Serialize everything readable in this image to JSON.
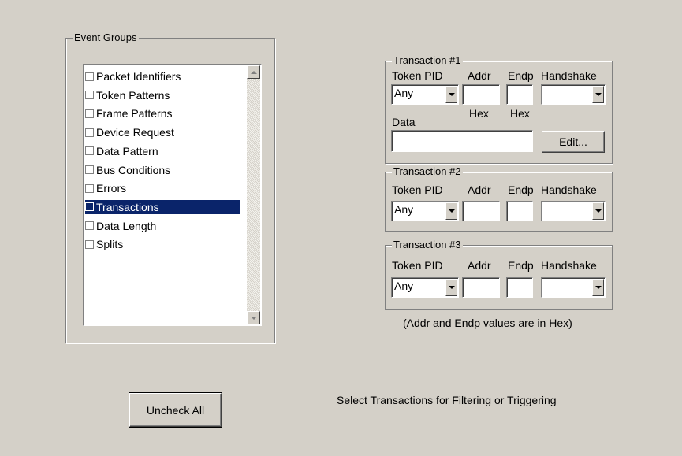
{
  "event_groups": {
    "title": "Event Groups",
    "items": [
      {
        "label": "Packet Identifiers",
        "checked": false,
        "selected": false
      },
      {
        "label": "Token Patterns",
        "checked": false,
        "selected": false
      },
      {
        "label": "Frame Patterns",
        "checked": false,
        "selected": false
      },
      {
        "label": "Device Request",
        "checked": false,
        "selected": false
      },
      {
        "label": "Data Pattern",
        "checked": false,
        "selected": false
      },
      {
        "label": "Bus Conditions",
        "checked": false,
        "selected": false
      },
      {
        "label": "Errors",
        "checked": false,
        "selected": false
      },
      {
        "label": "Transactions",
        "checked": false,
        "selected": true
      },
      {
        "label": "Data Length",
        "checked": false,
        "selected": false
      },
      {
        "label": "Splits",
        "checked": false,
        "selected": false
      }
    ]
  },
  "transaction1": {
    "title": "Transaction #1",
    "token_pid_label": "Token PID",
    "addr_label": "Addr",
    "endp_label": "Endp",
    "handshake_label": "Handshake",
    "token_pid_value": "Any",
    "addr_value": "",
    "endp_value": "",
    "handshake_value": "",
    "addr_hex_label": "Hex",
    "endp_hex_label": "Hex",
    "data_label": "Data",
    "data_value": "",
    "edit_button": "Edit..."
  },
  "transaction2": {
    "title": "Transaction #2",
    "token_pid_label": "Token PID",
    "addr_label": "Addr",
    "endp_label": "Endp",
    "handshake_label": "Handshake",
    "token_pid_value": "Any",
    "addr_value": "",
    "endp_value": "",
    "handshake_value": ""
  },
  "transaction3": {
    "title": "Transaction #3",
    "token_pid_label": "Token PID",
    "addr_label": "Addr",
    "endp_label": "Endp",
    "handshake_label": "Handshake",
    "token_pid_value": "Any",
    "addr_value": "",
    "endp_value": "",
    "handshake_value": ""
  },
  "hex_note": "(Addr and Endp values are in Hex)",
  "uncheck_all_button": "Uncheck All",
  "status_text": "Select Transactions for Filtering or Triggering",
  "colors": {
    "background": "#d4d0c8",
    "selection": "#0a246a"
  }
}
